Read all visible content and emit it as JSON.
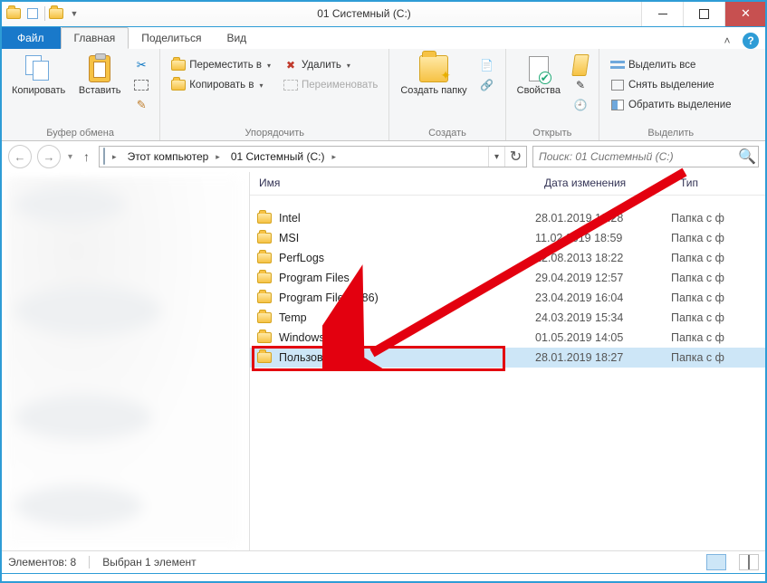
{
  "window": {
    "title": "01 Системный (C:)",
    "qat_dropdown": "▼"
  },
  "tabs": {
    "file": "Файл",
    "items": [
      {
        "label": "Главная",
        "active": true
      },
      {
        "label": "Поделиться",
        "active": false
      },
      {
        "label": "Вид",
        "active": false
      }
    ]
  },
  "ribbon": {
    "clipboard": {
      "copy": "Копировать",
      "paste": "Вставить",
      "group": "Буфер обмена"
    },
    "organize": {
      "move_to": "Переместить в",
      "copy_to": "Копировать в",
      "delete": "Удалить",
      "rename": "Переименовать",
      "group": "Упорядочить"
    },
    "new": {
      "new_folder": "Создать папку",
      "group": "Создать"
    },
    "open": {
      "properties": "Свойства",
      "group": "Открыть"
    },
    "select": {
      "select_all": "Выделить все",
      "select_none": "Снять выделение",
      "invert": "Обратить выделение",
      "group": "Выделить"
    }
  },
  "breadcrumb": {
    "root": "Этот компьютер",
    "drive": "01 Системный (C:)"
  },
  "search": {
    "placeholder": "Поиск: 01 Системный (C:)"
  },
  "columns": {
    "name": "Имя",
    "date": "Дата изменения",
    "type": "Тип"
  },
  "items": [
    {
      "name": "Intel",
      "date": "28.01.2019 19:28",
      "type": "Папка с ф"
    },
    {
      "name": "MSI",
      "date": "11.02.2019 18:59",
      "type": "Папка с ф"
    },
    {
      "name": "PerfLogs",
      "date": "22.08.2013 18:22",
      "type": "Папка с ф"
    },
    {
      "name": "Program Files",
      "date": "29.04.2019 12:57",
      "type": "Папка с ф"
    },
    {
      "name": "Program Files (x86)",
      "date": "23.04.2019 16:04",
      "type": "Папка с ф"
    },
    {
      "name": "Temp",
      "date": "24.03.2019 15:34",
      "type": "Папка с ф"
    },
    {
      "name": "Windows",
      "date": "01.05.2019 14:05",
      "type": "Папка с ф"
    },
    {
      "name": "Пользователи",
      "date": "28.01.2019 18:27",
      "type": "Папка с ф",
      "selected": true
    }
  ],
  "status": {
    "count": "Элементов: 8",
    "selected": "Выбран 1 элемент"
  }
}
